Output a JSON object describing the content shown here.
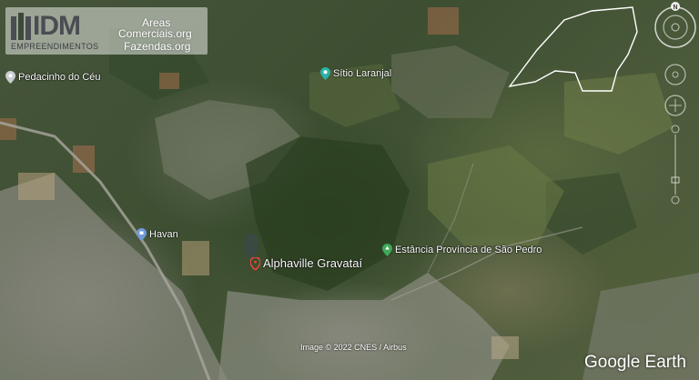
{
  "logo": {
    "brand": "IDM",
    "subtitle": "EMPREENDIMENTOS",
    "line_areas": "Areas",
    "line_comerciais": "Comerciais.org",
    "line_fazendas": "Fazendas.org"
  },
  "places": {
    "pedacinho": "Pedacinho do Céu",
    "sitio": "Sítio Laranjal",
    "havan": "Havan",
    "alphaville": "Alphaville Gravataí",
    "estancia": "Estância Província de São Pedro"
  },
  "compass": {
    "north": "N"
  },
  "attribution": "Image © 2022 CNES / Airbus",
  "brand": "Google Earth",
  "colors": {
    "pin_red": "#e8453c",
    "pin_teal": "#2ab3a6",
    "pin_blue": "#6f9bd8",
    "pin_gray": "#c9ccd1",
    "boundary": "#ffffff"
  }
}
